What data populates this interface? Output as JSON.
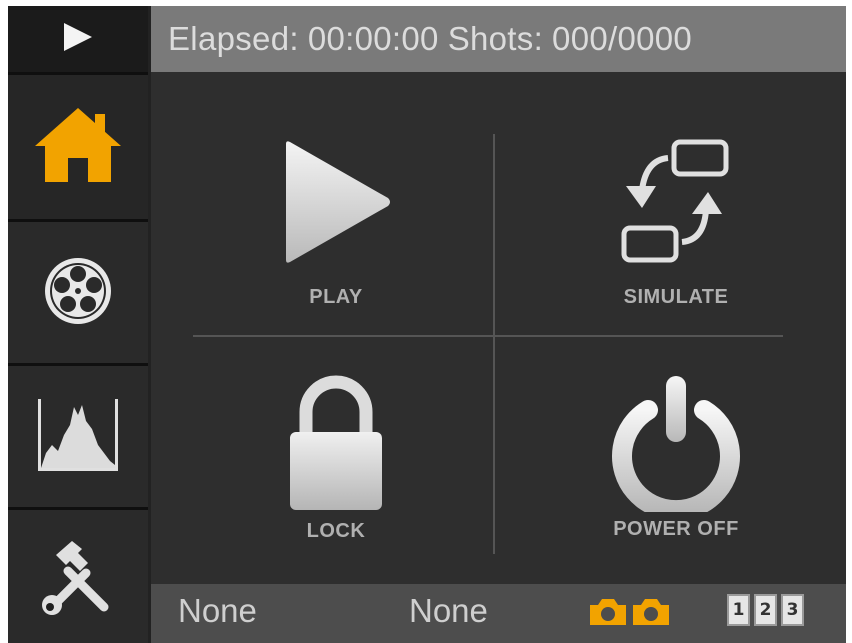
{
  "header": {
    "elapsed_label": "Elapsed:",
    "elapsed_value": "00:00:00",
    "shots_label": "Shots:",
    "shots_value": "000/0000"
  },
  "sidebar": {
    "items": [
      {
        "icon": "play-icon"
      },
      {
        "icon": "home-icon",
        "active": true,
        "color": "#f2a300"
      },
      {
        "icon": "film-reel-icon"
      },
      {
        "icon": "histogram-icon"
      },
      {
        "icon": "tools-icon"
      }
    ]
  },
  "main": {
    "tiles": [
      {
        "label": "PLAY",
        "icon": "play-icon"
      },
      {
        "label": "SIMULATE",
        "icon": "simulate-icon"
      },
      {
        "label": "LOCK",
        "icon": "lock-icon"
      },
      {
        "label": "POWER OFF",
        "icon": "power-icon"
      }
    ]
  },
  "footer": {
    "value_1": "None",
    "value_2": "None",
    "cameras": [
      {
        "icon": "camera-icon",
        "color": "#f2a300"
      },
      {
        "icon": "camera-icon",
        "color": "#f2a300"
      }
    ],
    "badges": [
      "1",
      "2",
      "3"
    ]
  }
}
